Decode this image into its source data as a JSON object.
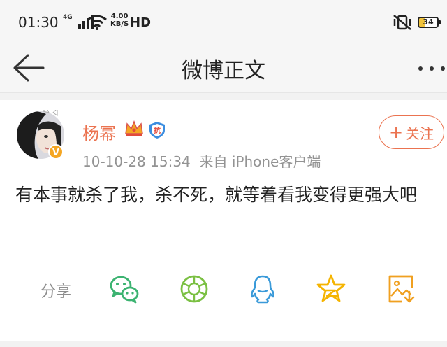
{
  "status_bar": {
    "time": "01:30",
    "network": "4G",
    "speed_value": "4.00",
    "speed_unit": "KB/S",
    "hd": "HD",
    "battery": "34"
  },
  "nav": {
    "title": "微博正文"
  },
  "post": {
    "username": "杨幂",
    "timestamp": "10-10-28 15:34",
    "source": "来自 iPhone客户端",
    "follow_plus": "+",
    "follow_label": "关注",
    "text": "有本事就杀了我，杀不死，就等着看我变得更强大吧"
  },
  "share": {
    "label": "分享",
    "targets": [
      {
        "icon": "wechat-icon",
        "color": "#3cb371"
      },
      {
        "icon": "moments-icon",
        "color": "#7bc043"
      },
      {
        "icon": "qq-icon",
        "color": "#3a9ad9"
      },
      {
        "icon": "qzone-star-icon",
        "color": "#f5b400"
      },
      {
        "icon": "save-image-icon",
        "color": "#f0a020"
      }
    ]
  },
  "colors": {
    "accent": "#eb7350",
    "verified": "#f5a623",
    "meta_text": "#939393"
  }
}
